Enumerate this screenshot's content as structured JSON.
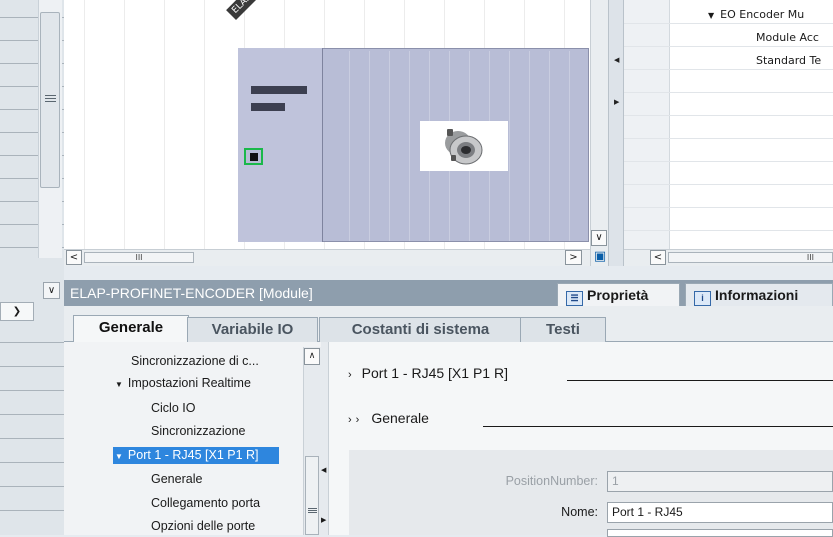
{
  "device_view": {
    "device_tag": "ELAP",
    "scroll_thumb_grip": "III"
  },
  "overview": {
    "rows": [
      "EO Encoder Mu",
      "Module Acc",
      "Standard Te"
    ],
    "scroll_thumb_grip": "III"
  },
  "inspector": {
    "title": "ELAP-PROFINET-ENCODER [Module]",
    "tabs": [
      {
        "label": "Proprietà",
        "icon": "properties-icon"
      },
      {
        "label": "Informazioni",
        "icon": "info-icon"
      }
    ]
  },
  "property_tabs": [
    "Generale",
    "Variabile IO",
    "Costanti di sistema",
    "Testi"
  ],
  "nav": {
    "items": [
      {
        "label": "Sincronizzazione di c..."
      },
      {
        "label": "Impostazioni Realtime"
      },
      {
        "label": "Ciclo IO"
      },
      {
        "label": "Sincronizzazione"
      },
      {
        "label": "Port 1 - RJ45 [X1 P1 R]"
      },
      {
        "label": "Generale"
      },
      {
        "label": "Collegamento porta"
      },
      {
        "label": "Opzioni delle porte"
      }
    ],
    "selected": "Port 1 - RJ45 [X1 P1 R]"
  },
  "content": {
    "section_title": "Port 1 - RJ45 [X1 P1 R]",
    "subsection_title": "Generale",
    "fields": {
      "position_number": {
        "label": "PositionNumber:",
        "value": "1"
      },
      "nome": {
        "label": "Nome:",
        "value": "Port 1 - RJ45"
      }
    }
  },
  "colors": {
    "selection": "#2e86de",
    "inspector_header": "#8e9ead",
    "device_module": "#b8bdd6",
    "port_highlight": "#1ab84a"
  }
}
